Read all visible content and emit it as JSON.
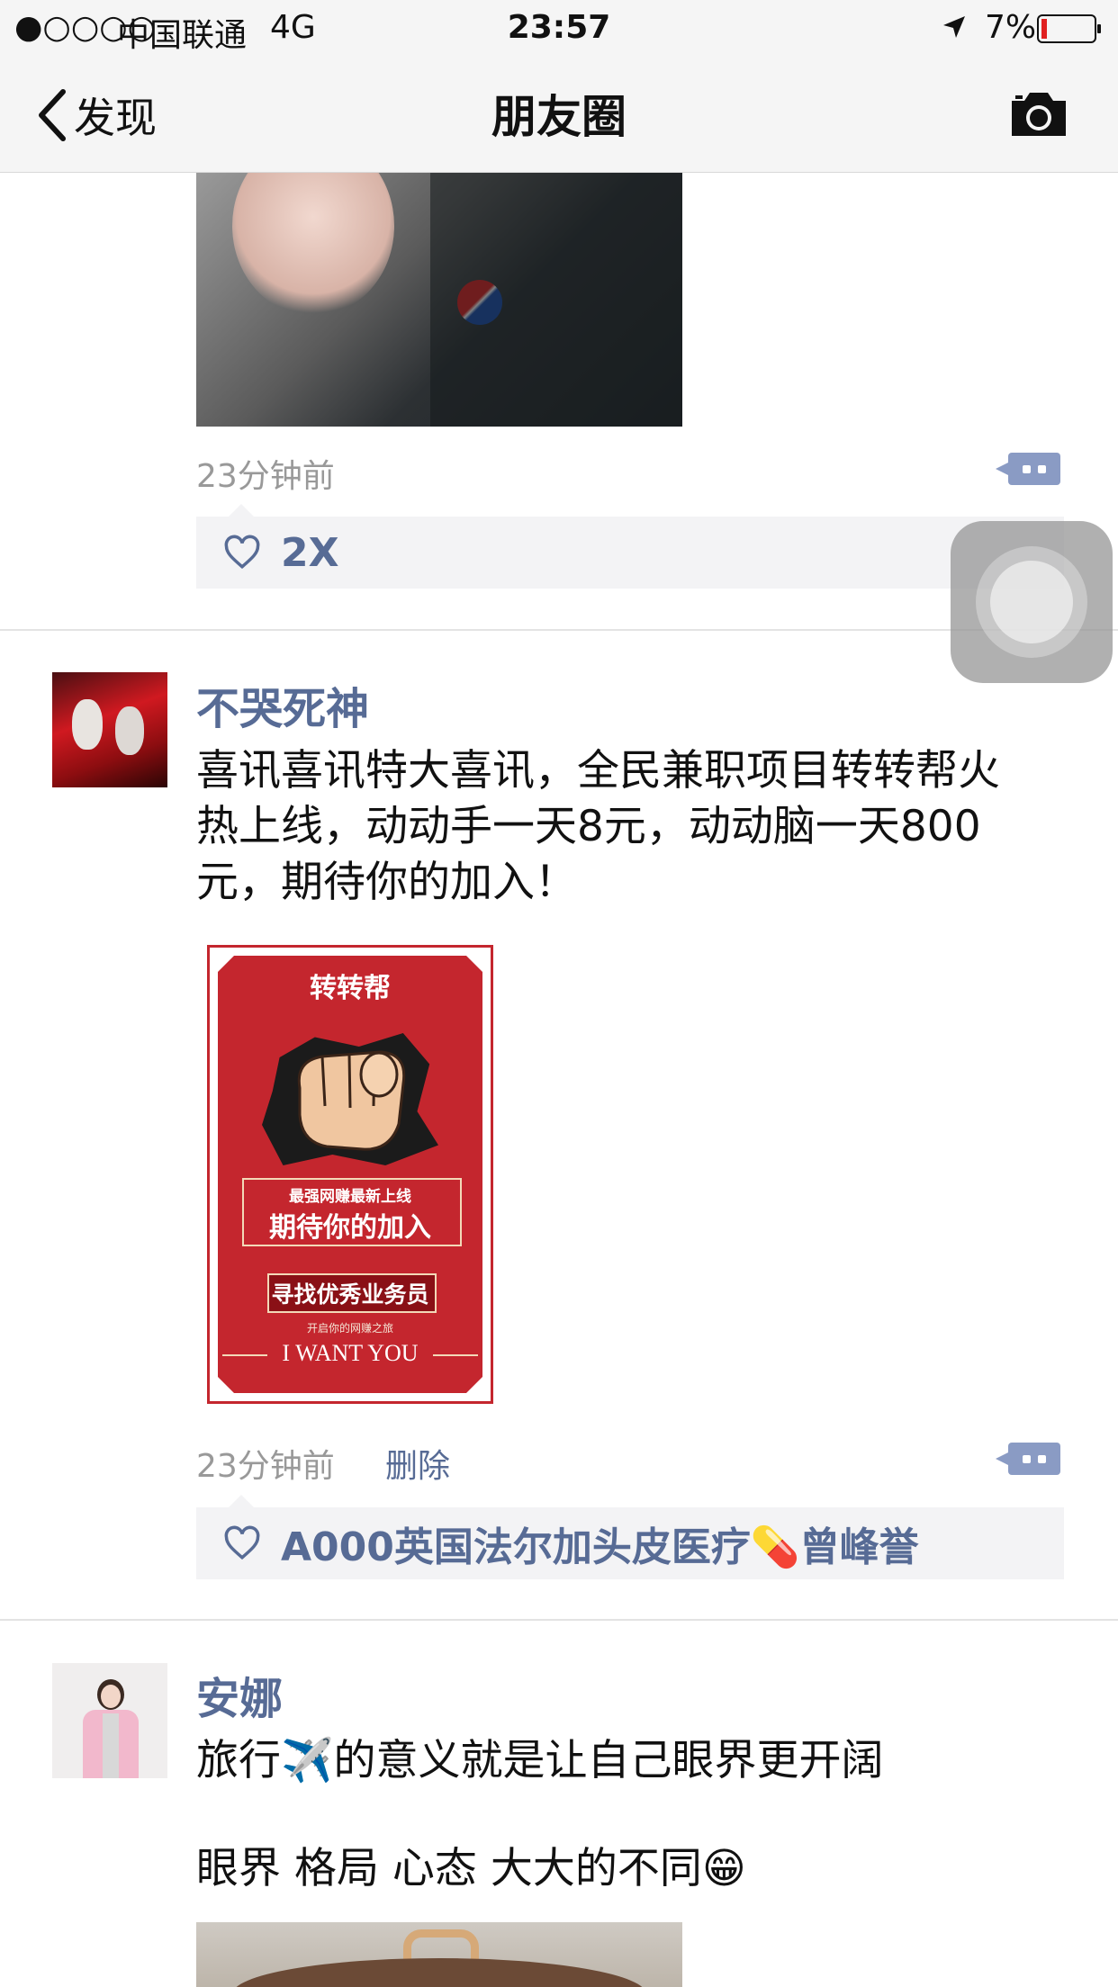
{
  "status_bar": {
    "signal": "●○○○○",
    "carrier": "中国联通",
    "network": "4G",
    "time": "23:57",
    "battery": "7%"
  },
  "nav": {
    "back_label": "发现",
    "title": "朋友圈"
  },
  "posts": [
    {
      "time": "23分钟前",
      "likes": "2X"
    },
    {
      "name": "不哭死神",
      "text_lines": [
        "喜讯喜讯特大喜讯，全民兼职项目转转帮火",
        "热上线，动动手一天8元，动动脑一天800",
        "元，期待你的加入！"
      ],
      "poster": {
        "title": "转转帮",
        "line1": "最强网赚最新上线",
        "line2": "期待你的加入",
        "line3": "寻找优秀业务员",
        "line4": "开启你的网赚之旅",
        "line5": "I WANT YOU"
      },
      "time": "23分钟前",
      "delete_label": "删除",
      "likes": "A000英国法尔加头皮医疗💊曾峰誉"
    },
    {
      "name": "安娜",
      "text_line1": "旅行✈️的意义就是让自己眼界更开阔",
      "text_line2": "眼界 格局 心态 大大的不同😁"
    }
  ],
  "colors": {
    "link": "#576b95",
    "poster_red": "#c4262e"
  }
}
